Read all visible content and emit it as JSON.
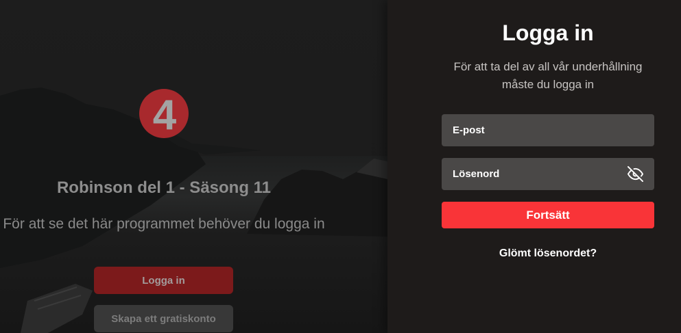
{
  "left": {
    "logo_text": "4",
    "program_title": "Robinson del 1 - Säsong 11",
    "message": "För att se det här programmet behöver du logga in",
    "login_button": "Logga in",
    "signup_button": "Skapa ett gratiskonto"
  },
  "login_panel": {
    "title": "Logga in",
    "description": "För att ta del av all vår underhållning måste du logga in",
    "email": {
      "placeholder": "E-post"
    },
    "password": {
      "placeholder": "Lösenord",
      "toggle_icon": "eye-slash-icon"
    },
    "submit_label": "Fortsätt",
    "forgot_password": "Glömt lösenordet?"
  },
  "colors": {
    "brand_red": "#f93438",
    "panel_background": "#1e1b1a",
    "field_background": "#4a4847",
    "logo_red": "#a8292d"
  }
}
